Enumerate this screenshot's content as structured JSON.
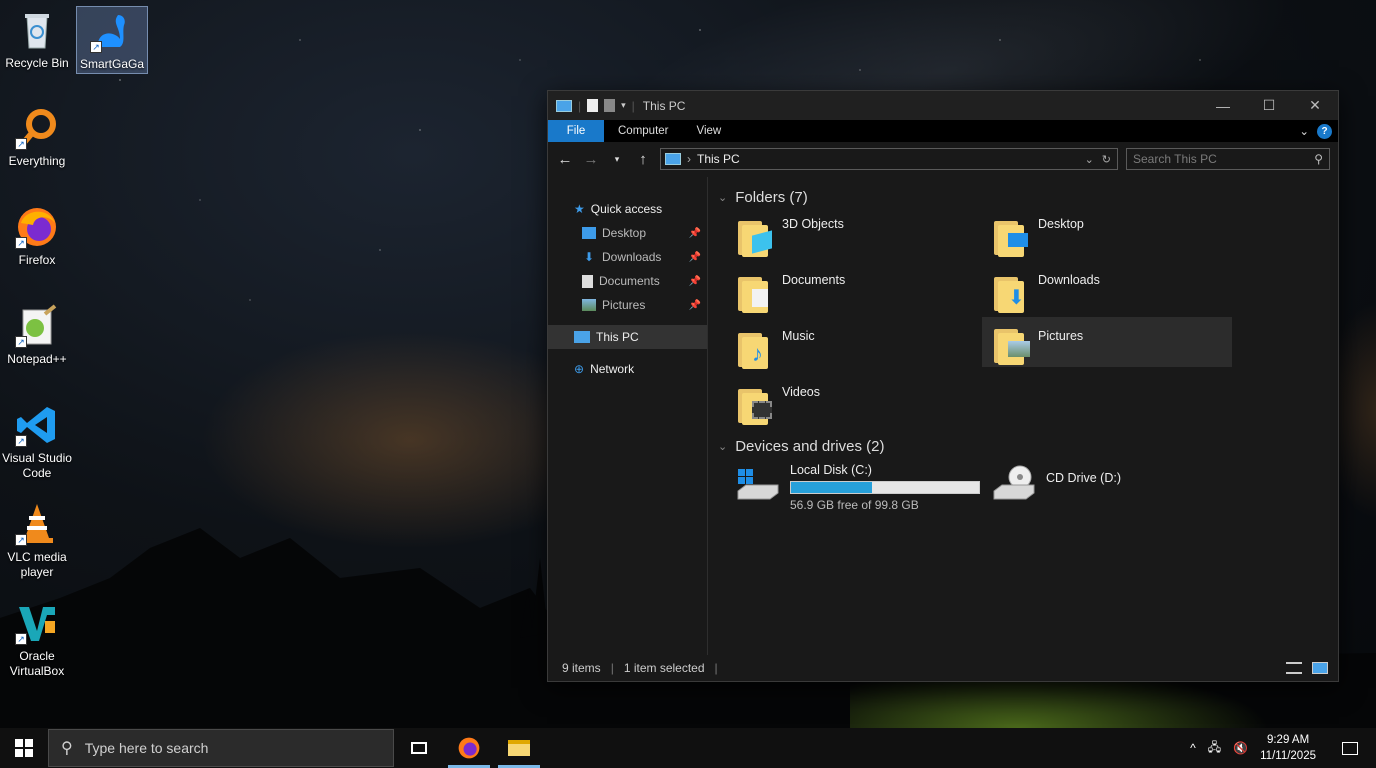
{
  "desktop": {
    "icons": [
      {
        "label": "Recycle Bin"
      },
      {
        "label": "SmartGaGa"
      },
      {
        "label": "Everything"
      },
      {
        "label": "Firefox"
      },
      {
        "label": "Notepad++"
      },
      {
        "label": "Visual Studio Code"
      },
      {
        "label": "VLC media player"
      },
      {
        "label": "Oracle VirtualBox"
      }
    ]
  },
  "explorer": {
    "title": "This PC",
    "ribbon_tabs": [
      "File",
      "Computer",
      "View"
    ],
    "address": "This PC",
    "search_placeholder": "Search This PC",
    "nav": {
      "quick_access": "Quick access",
      "quick_items": [
        "Desktop",
        "Downloads",
        "Documents",
        "Pictures"
      ],
      "this_pc": "This PC",
      "network": "Network"
    },
    "folders_header": "Folders (7)",
    "folders": [
      "3D Objects",
      "Desktop",
      "Documents",
      "Downloads",
      "Music",
      "Pictures",
      "Videos"
    ],
    "drives_header": "Devices and drives (2)",
    "drives": [
      {
        "name": "Local Disk (C:)",
        "free_text": "56.9 GB free of 99.8 GB",
        "used_fraction": 0.43
      },
      {
        "name": "CD Drive (D:)"
      }
    ],
    "status": {
      "items": "9 items",
      "selected": "1 item selected"
    }
  },
  "taskbar": {
    "search_placeholder": "Type here to search",
    "time": "9:29 AM",
    "date": "11/11/2025"
  },
  "colors": {
    "accent": "#1979ca",
    "progress": "#26a0da",
    "folder": "#f7d774"
  }
}
